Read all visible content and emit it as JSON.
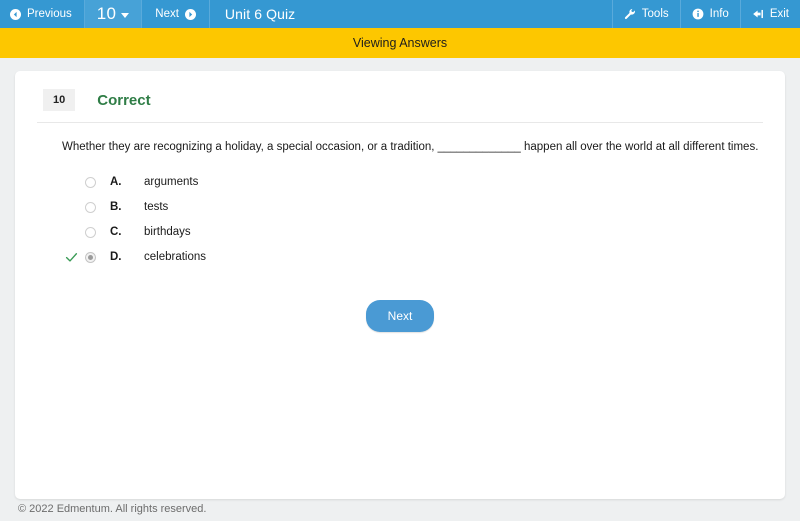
{
  "topbar": {
    "previous_label": "Previous",
    "question_number": "10",
    "next_label": "Next",
    "quiz_title": "Unit 6 Quiz",
    "tools_label": "Tools",
    "info_label": "Info",
    "exit_label": "Exit",
    "background_color": "#3598d2",
    "question_selector_color": "#47a2d7"
  },
  "banner": {
    "text": "Viewing Answers",
    "background_color": "#fdc700"
  },
  "question": {
    "number_badge": "10",
    "status": "Correct",
    "status_color": "#2f7d46",
    "text": "Whether they are recognizing a holiday, a special occasion, or a tradition, _____________ happen all over the world at all different times.",
    "options": [
      {
        "letter": "A.",
        "text": "arguments",
        "selected": false,
        "correct_mark": false
      },
      {
        "letter": "B.",
        "text": "tests",
        "selected": false,
        "correct_mark": false
      },
      {
        "letter": "C.",
        "text": "birthdays",
        "selected": false,
        "correct_mark": false
      },
      {
        "letter": "D.",
        "text": "celebrations",
        "selected": true,
        "correct_mark": true
      }
    ]
  },
  "actions": {
    "next_button_label": "Next",
    "next_button_color": "#4a9ad4"
  },
  "footer": {
    "copyright": "© 2022 Edmentum. All rights reserved."
  }
}
